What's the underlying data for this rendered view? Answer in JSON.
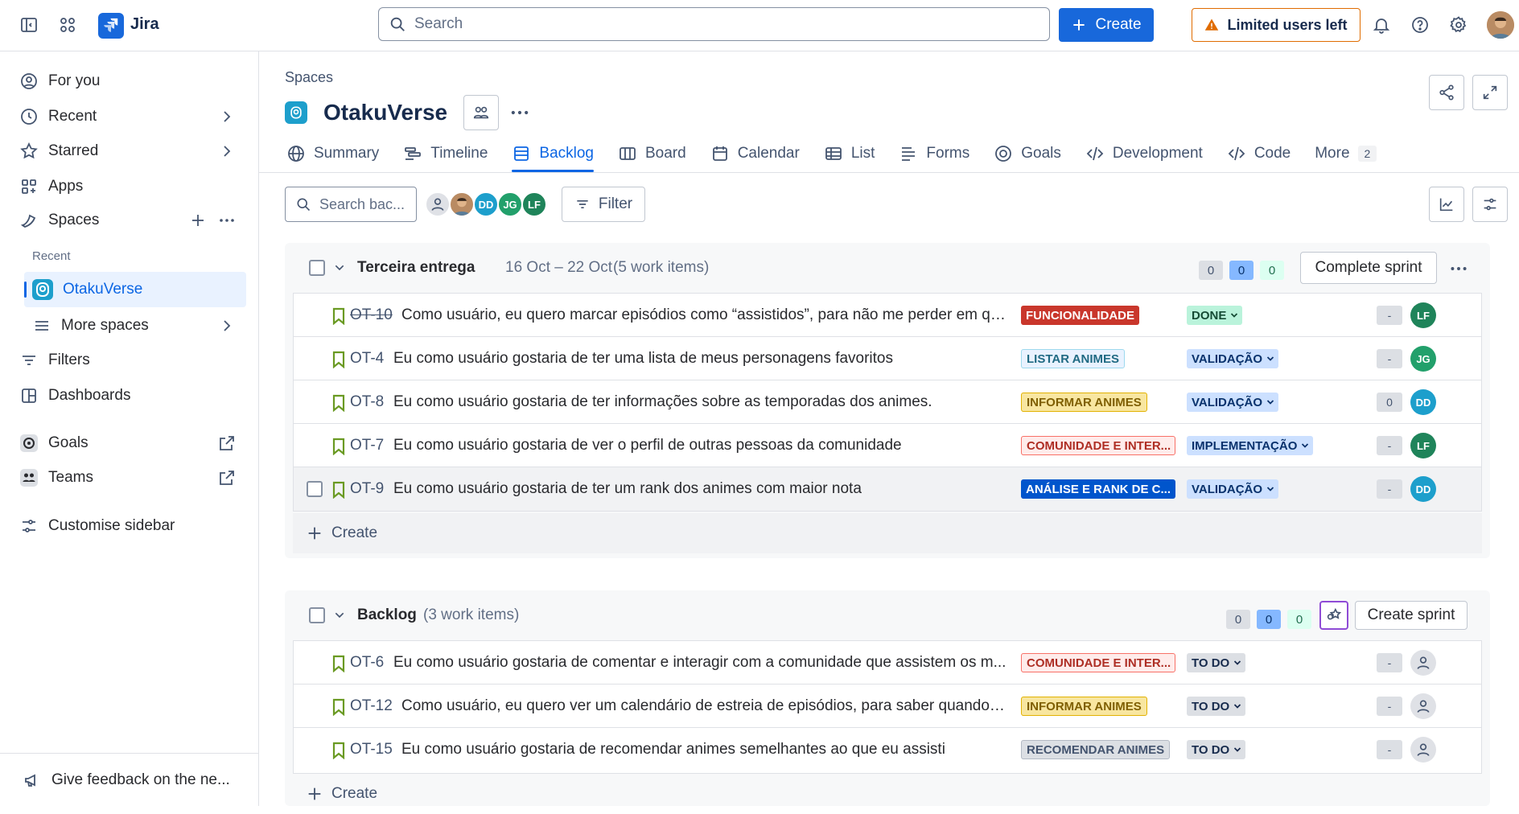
{
  "topbar": {
    "app_name": "Jira",
    "search_placeholder": "Search",
    "create_label": "Create",
    "limited_label": "Limited users left"
  },
  "sidebar": {
    "items": [
      {
        "label": "For you"
      },
      {
        "label": "Recent"
      },
      {
        "label": "Starred"
      },
      {
        "label": "Apps"
      },
      {
        "label": "Spaces"
      }
    ],
    "recent_header": "Recent",
    "recent_project": "OtakuVerse",
    "more_spaces": "More spaces",
    "filters": "Filters",
    "dashboards": "Dashboards",
    "goals": "Goals",
    "teams": "Teams",
    "customise": "Customise sidebar",
    "feedback": "Give feedback on the ne..."
  },
  "main": {
    "breadcrumb": "Spaces",
    "project_title": "OtakuVerse",
    "tabs": [
      {
        "label": "Summary"
      },
      {
        "label": "Timeline"
      },
      {
        "label": "Backlog"
      },
      {
        "label": "Board"
      },
      {
        "label": "Calendar"
      },
      {
        "label": "List"
      },
      {
        "label": "Forms"
      },
      {
        "label": "Goals"
      },
      {
        "label": "Development"
      },
      {
        "label": "Code"
      },
      {
        "label": "More"
      }
    ],
    "more_count": "2",
    "search_placeholder": "Search bac...",
    "filter_label": "Filter",
    "avatars": [
      "DD",
      "JG",
      "LF"
    ]
  },
  "sprint": {
    "title": "Terceira entrega",
    "dates": "16 Oct – 22 Oct",
    "count": "(5 work items)",
    "points": [
      "0",
      "0",
      "0"
    ],
    "action": "Complete sprint",
    "create_label": "Create",
    "rows": [
      {
        "key": "OT-10",
        "summary": "Como usuário, eu quero marcar episódios como “assistidos”, para não me perder em qu...",
        "epic": "FUNCIONALIDADE",
        "status": "DONE",
        "estimate": "-",
        "assignee": "LF"
      },
      {
        "key": "OT-4",
        "summary": "Eu como usuário gostaria de ter uma lista de meus personagens favoritos",
        "epic": "LISTAR ANIMES",
        "status": "VALIDAÇÃO",
        "estimate": "-",
        "assignee": "JG"
      },
      {
        "key": "OT-8",
        "summary": "Eu como usuário gostaria de ter informações sobre as temporadas dos animes.",
        "epic": "INFORMAR ANIMES",
        "status": "VALIDAÇÃO",
        "estimate": "0",
        "assignee": "DD"
      },
      {
        "key": "OT-7",
        "summary": "Eu como usuário gostaria de ver o perfil de outras pessoas da comunidade",
        "epic": "COMUNIDADE E INTER...",
        "status": "IMPLEMENTAÇÃO",
        "estimate": "-",
        "assignee": "LF"
      },
      {
        "key": "OT-9",
        "summary": "Eu como usuário gostaria de ter um rank dos animes com maior nota",
        "epic": "ANÁLISE E RANK DE C...",
        "status": "VALIDAÇÃO",
        "estimate": "-",
        "assignee": "DD"
      }
    ]
  },
  "backlog": {
    "title": "Backlog",
    "count": "(3 work items)",
    "points": [
      "0",
      "0",
      "0"
    ],
    "action": "Create sprint",
    "create_label": "Create",
    "rows": [
      {
        "key": "OT-6",
        "summary": "Eu como usuário gostaria de comentar e interagir com a comunidade que assistem os m...",
        "epic": "COMUNIDADE E INTER...",
        "status": "TO DO",
        "estimate": "-"
      },
      {
        "key": "OT-12",
        "summary": "Como usuário, eu quero ver um calendário de estreia de episódios, para saber quando s...",
        "epic": "INFORMAR ANIMES",
        "status": "TO DO",
        "estimate": "-"
      },
      {
        "key": "OT-15",
        "summary": "Eu como usuário gostaria de recomendar animes semelhantes ao que eu assisti",
        "epic": "RECOMENDAR ANIMES",
        "status": "TO DO",
        "estimate": "-"
      }
    ]
  },
  "colors": {
    "brand": "#1868db",
    "active": "#0c66e4",
    "warning": "#e06c00",
    "epic_red": "#c9372c",
    "epic_teal": "#cce0ff",
    "epic_yellow": "#f8e6a0",
    "epic_pink": "#ffd5d2",
    "epic_blue": "#0055cc",
    "epic_gray": "#dcdfe4",
    "status_done": "#baf3db",
    "status_blue": "#cce0ff",
    "status_todo": "#dcdfe4",
    "av_dd": "#1d9fcc",
    "av_jg": "#22a06b",
    "av_lf": "#1f845a"
  },
  "icons": [
    "sidebar-toggle-icon",
    "app-switcher-icon",
    "jira-logo-icon",
    "search-icon",
    "plus-icon",
    "warning-icon",
    "bell-icon",
    "help-icon",
    "gear-icon",
    "person-icon",
    "clock-icon",
    "star-icon",
    "apps-icon",
    "spaces-icon",
    "chevron-right-icon",
    "more-icon",
    "list-icon",
    "filter-icon",
    "dashboard-icon",
    "goals-icon",
    "teams-icon",
    "customise-icon",
    "megaphone-icon",
    "share-icon",
    "expand-icon",
    "globe-icon",
    "timeline-icon",
    "backlog-icon",
    "board-icon",
    "calendar-icon",
    "table-icon",
    "forms-icon",
    "code-icon",
    "chart-icon",
    "settings-sliders-icon",
    "bookmark-icon",
    "chevron-down-icon",
    "people-icon",
    "avatar-placeholder-icon"
  ]
}
